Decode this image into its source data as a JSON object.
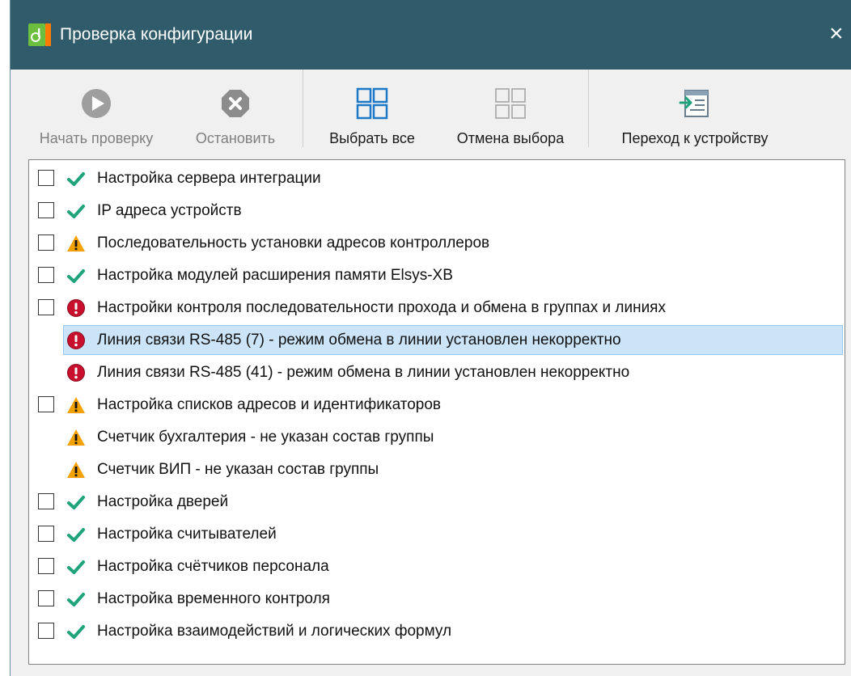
{
  "window": {
    "title": "Проверка конфигурации",
    "close_glyph": "×"
  },
  "toolbar": {
    "start": {
      "label": "Начать проверку",
      "icon": "play-icon",
      "enabled": false
    },
    "stop": {
      "label": "Остановить",
      "icon": "stop-icon",
      "enabled": false
    },
    "select_all": {
      "label": "Выбрать все",
      "icon": "select-all-icon",
      "enabled": true
    },
    "deselect": {
      "label": "Отмена выбора",
      "icon": "deselect-icon",
      "enabled": true
    },
    "goto_device": {
      "label": "Переход к устройству",
      "icon": "goto-device-icon",
      "enabled": true
    }
  },
  "colors": {
    "titlebar": "#2f5b6b",
    "ok": "#1ea37a",
    "warning": "#f2a100",
    "error": "#c8102e",
    "selection": "#cce4f7"
  },
  "checks": [
    {
      "label": "Настройка сервера интеграции",
      "status": "ok",
      "checked": false,
      "has_checkbox": true,
      "selected": false
    },
    {
      "label": "IP адреса устройств",
      "status": "ok",
      "checked": false,
      "has_checkbox": true,
      "selected": false
    },
    {
      "label": "Последовательность установки адресов контроллеров",
      "status": "warning",
      "checked": false,
      "has_checkbox": true,
      "selected": false
    },
    {
      "label": "Настройка модулей расширения памяти Elsys-XB",
      "status": "ok",
      "checked": false,
      "has_checkbox": true,
      "selected": false
    },
    {
      "label": "Настройки контроля последовательности прохода и обмена в группах и линиях",
      "status": "error",
      "checked": false,
      "has_checkbox": true,
      "selected": false
    },
    {
      "label": "Линия связи RS-485 (7) - режим обмена в линии установлен некорректно",
      "status": "error",
      "checked": false,
      "has_checkbox": false,
      "selected": true
    },
    {
      "label": "Линия связи RS-485 (41) - режим обмена в линии установлен некорректно",
      "status": "error",
      "checked": false,
      "has_checkbox": false,
      "selected": false
    },
    {
      "label": "Настройка списков адресов и идентификаторов",
      "status": "warning",
      "checked": false,
      "has_checkbox": true,
      "selected": false
    },
    {
      "label": "Счетчик бухгалтерия - не указан состав группы",
      "status": "warning",
      "checked": false,
      "has_checkbox": false,
      "selected": false
    },
    {
      "label": "Счетчик ВИП - не указан состав группы",
      "status": "warning",
      "checked": false,
      "has_checkbox": false,
      "selected": false
    },
    {
      "label": "Настройка дверей",
      "status": "ok",
      "checked": false,
      "has_checkbox": true,
      "selected": false
    },
    {
      "label": "Настройка считывателей",
      "status": "ok",
      "checked": false,
      "has_checkbox": true,
      "selected": false
    },
    {
      "label": "Настройка счётчиков персонала",
      "status": "ok",
      "checked": false,
      "has_checkbox": true,
      "selected": false
    },
    {
      "label": "Настройка временного контроля",
      "status": "ok",
      "checked": false,
      "has_checkbox": true,
      "selected": false
    },
    {
      "label": "Настройка взаимодействий и логических формул",
      "status": "ok",
      "checked": false,
      "has_checkbox": true,
      "selected": false
    }
  ]
}
